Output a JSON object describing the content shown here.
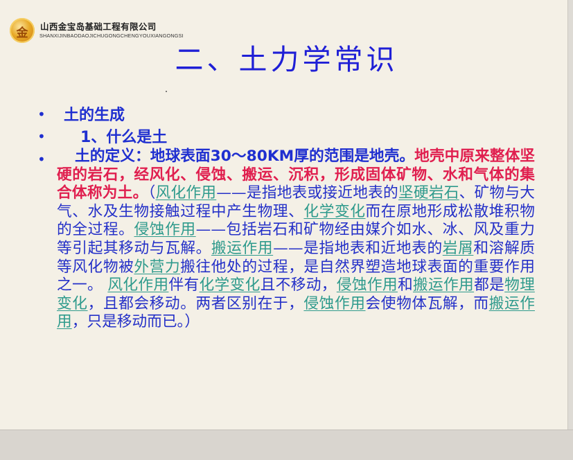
{
  "company": {
    "name_cn": "山西金宝岛基础工程有限公司",
    "name_en": "SHANXIJINBAODAOJICHUGONGCHENGYOUXIANGONGSI",
    "logo_char": "金"
  },
  "slide": {
    "title": "二、土力学常识",
    "bullets": [
      "土的生成",
      "1、什么是土"
    ],
    "paragraph": {
      "definition_lead": "土的定义：地球表面30～80KM厚的范围是地壳。",
      "definition_main": "地壳中原来整体坚硬的岩石，经风化、侵蚀、搬运、沉积，形成固体矿物、水和气体的集合体称为土。",
      "t0": "（",
      "l1": "风化作用",
      "t1": "——是指地表或接近地表的",
      "l2": "坚硬岩石",
      "t2": "、矿物与大气、水及生物接触过程中产生物理、",
      "l3": "化学变化",
      "t3": "而在原地形成松散堆积物的全过程。",
      "l4": "侵蚀作用",
      "t4": "——包括岩石和矿物经由媒介如水、冰、风及重力等引起其移动与瓦解。",
      "l5": "搬运作用",
      "t5": "——是指地表和近地表的",
      "l6": "岩屑",
      "t6": "和溶解质等风化物被",
      "l7": "外营力",
      "t7": "搬往他处的过程，是自然界塑造地球表面的重要作用之一。 ",
      "l8": "风化作用",
      "t8": "伴有",
      "l9": "化学变化",
      "t9": "且不移动，",
      "l10": "侵蚀作用",
      "t10": "和",
      "l11": "搬运作用",
      "t11": "都是",
      "l12": "物理变化",
      "t12": "，且都会移动。两者区别在于，",
      "l13": "侵蚀作用",
      "t13": "会使物体瓦解，而",
      "l14": "搬运作用",
      "t14": "，只是移动而已。）"
    }
  },
  "colors": {
    "title": "#1f1fd6",
    "body_text": "#2430c8",
    "emphasis_red": "#e01f4f",
    "link_teal": "#2e9a8c",
    "background": "#f4f0e6"
  }
}
